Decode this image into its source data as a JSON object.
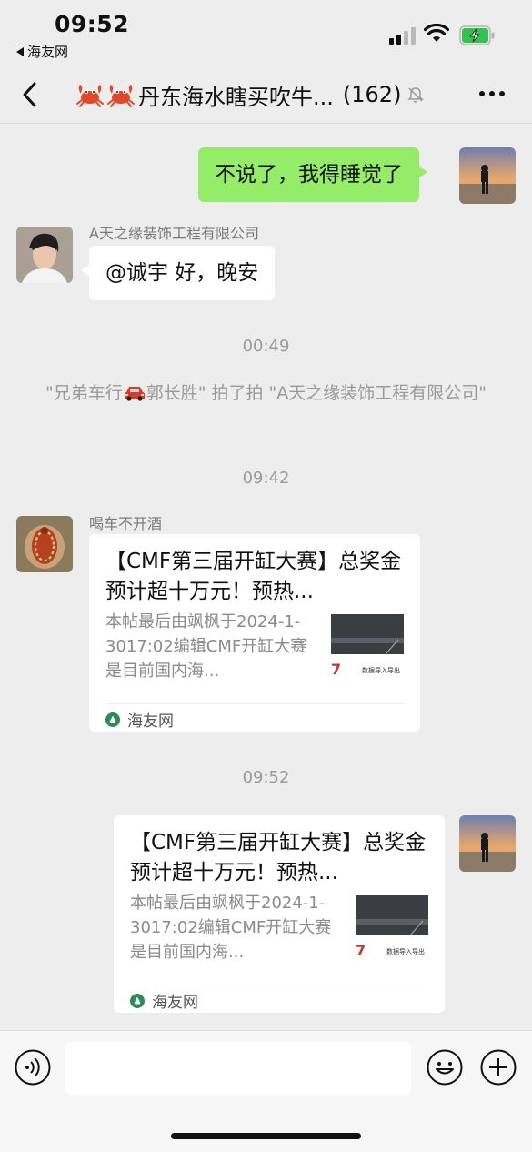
{
  "status_bar": {
    "time": "09:52",
    "back_app": "海友网"
  },
  "nav": {
    "title": "丹东海水瞎买吹牛...",
    "member_count": "(162)",
    "icons": [
      "back-chevron-icon",
      "crab-icon",
      "mute-bell-icon",
      "more-dots-icon"
    ]
  },
  "messages": [
    {
      "type": "text",
      "side": "right",
      "text": "不说了，我得睡觉了"
    },
    {
      "type": "text",
      "side": "left",
      "sender": "A天之缘装饰工程有限公司",
      "text": "@诚宇 好，晚安"
    },
    {
      "type": "timestamp",
      "text": "00:49"
    },
    {
      "type": "system",
      "before": "\"兄弟车行",
      "after": "郭长胜\" 拍了拍 \"A天之缘装饰工程有限公司\""
    },
    {
      "type": "timestamp",
      "text": "09:42"
    },
    {
      "type": "card",
      "side": "left",
      "sender": "喝车不开酒",
      "title": "【CMF第三届开缸大赛】总奖金预计超十万元！预热...",
      "desc": "本帖最后由飒枫于2024-1-3017:02编辑CMF开缸大赛是目前国内海...",
      "source": "海友网",
      "thumb_text": "数据导入导出"
    },
    {
      "type": "timestamp",
      "text": "09:52"
    },
    {
      "type": "card",
      "side": "right",
      "title": "【CMF第三届开缸大赛】总奖金预计超十万元！预热...",
      "desc": "本帖最后由飒枫于2024-1-3017:02编辑CMF开缸大赛是目前国内海...",
      "source": "海友网",
      "thumb_text": "数据导入导出"
    }
  ],
  "input_bar": {
    "placeholder": "",
    "icons": [
      "voice-icon",
      "emoji-icon",
      "plus-icon"
    ]
  },
  "colors": {
    "background": "#ededed",
    "my_bubble": "#95ec69",
    "other_bubble": "#ffffff",
    "battery_green": "#32c24d"
  }
}
